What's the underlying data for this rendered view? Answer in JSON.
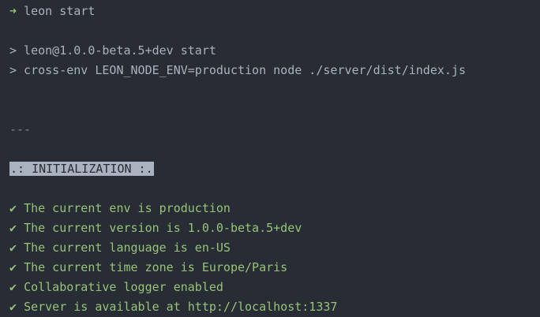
{
  "prompt": {
    "arrow": "➜",
    "command": "leon start"
  },
  "npm_output": [
    "> leon@1.0.0-beta.5+dev start",
    "> cross-env LEON_NODE_ENV=production node ./server/dist/index.js"
  ],
  "separator": "---",
  "section": {
    "title": ".: INITIALIZATION :."
  },
  "checks": [
    {
      "icon": "✔",
      "text": "The current env is production"
    },
    {
      "icon": "✔",
      "text": "The current version is 1.0.0-beta.5+dev"
    },
    {
      "icon": "✔",
      "text": "The current language is en-US"
    },
    {
      "icon": "✔",
      "text": "The current time zone is Europe/Paris"
    },
    {
      "icon": "✔",
      "text": "Collaborative logger enabled"
    },
    {
      "icon": "✔",
      "text": "Server is available at http://localhost:1337"
    }
  ],
  "colors": {
    "background": "#282c34",
    "foreground": "#abb2bf",
    "success": "#98c379"
  }
}
